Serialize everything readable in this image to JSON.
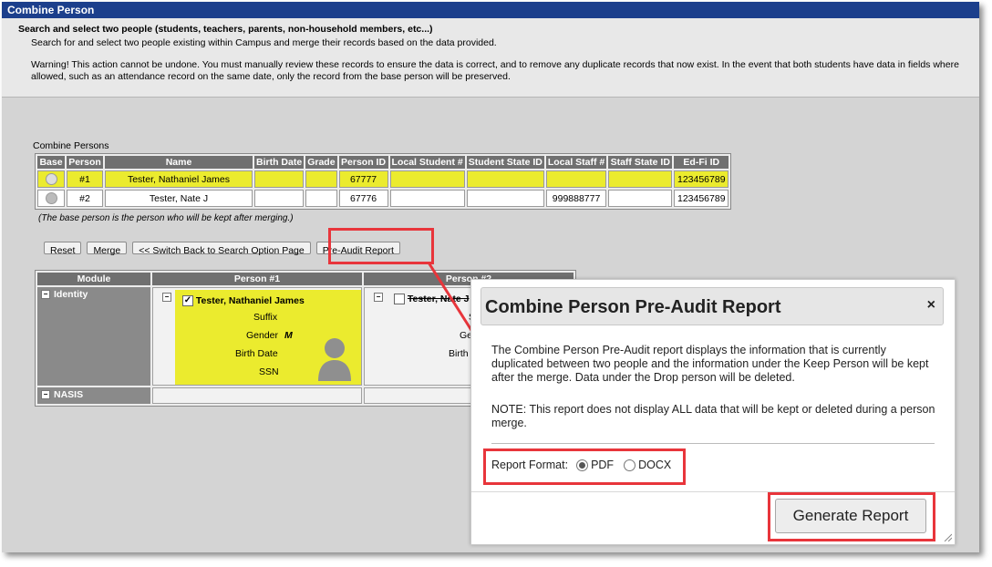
{
  "window": {
    "title": "Combine Person"
  },
  "instructions": {
    "heading": "Search and select two people (students, teachers, parents, non-household members, etc...)",
    "subtext": "Search for and select two people existing within Campus and merge their records based on the data provided.",
    "warning_line1": "Warning! This action cannot be undone. You must manually review these records to ensure the data is correct, and to remove any duplicate records that now exist. In the event that both students have data in fields where",
    "warning_line2": "allowed, such as an attendance record on the same date, only the record from the base person will be preserved."
  },
  "combine_persons": {
    "label": "Combine Persons",
    "columns": [
      "Base",
      "Person",
      "Name",
      "Birth Date",
      "Grade",
      "Person ID",
      "Local Student #",
      "Student State ID",
      "Local Staff #",
      "Staff State ID",
      "Ed-Fi ID"
    ],
    "rows": [
      {
        "person": "#1",
        "name": "Tester, Nathaniel James",
        "birth_date": "",
        "grade": "",
        "person_id": "67777",
        "local_student": "",
        "student_state_id": "",
        "local_staff": "",
        "staff_state_id": "",
        "edfi_id": "123456789"
      },
      {
        "person": "#2",
        "name": "Tester, Nate J",
        "birth_date": "",
        "grade": "",
        "person_id": "67776",
        "local_student": "",
        "student_state_id": "",
        "local_staff": "999888777",
        "staff_state_id": "",
        "edfi_id": "123456789"
      }
    ],
    "note": "(The base person is the person who will be kept after merging.)"
  },
  "buttons": {
    "reset": "Reset",
    "merge": "Merge",
    "switch_back": "<< Switch Back to Search Option Page",
    "pre_audit": "Pre-Audit Report"
  },
  "modules_table": {
    "headers": [
      "Module",
      "Person #1",
      "Person #2"
    ],
    "modules": [
      "Identity",
      "NASIS"
    ],
    "person1": {
      "name": "Tester, Nathaniel James",
      "fields": [
        "Suffix",
        "Gender",
        "Birth Date",
        "SSN"
      ],
      "gender_value": "M"
    },
    "person2": {
      "name": "Tester, Nate J",
      "fields": [
        "S",
        "Ge",
        "Birth",
        "S"
      ]
    }
  },
  "modal": {
    "title": "Combine Person Pre-Audit Report",
    "close": "×",
    "description": "The Combine Person Pre-Audit report displays the information that is currently duplicated between two people and the information under the Keep Person will be kept after the merge. Data under the Drop person will be deleted.",
    "note": "NOTE: This report does not display ALL data that will be kept or deleted during a person merge.",
    "format_label": "Report Format:",
    "format_options": [
      "PDF",
      "DOCX"
    ],
    "selected_format": "PDF",
    "generate_button": "Generate Report"
  },
  "colors": {
    "titlebar": "#1c3f8c",
    "highlight": "#e8353b",
    "base_row": "#ebeb2e"
  }
}
